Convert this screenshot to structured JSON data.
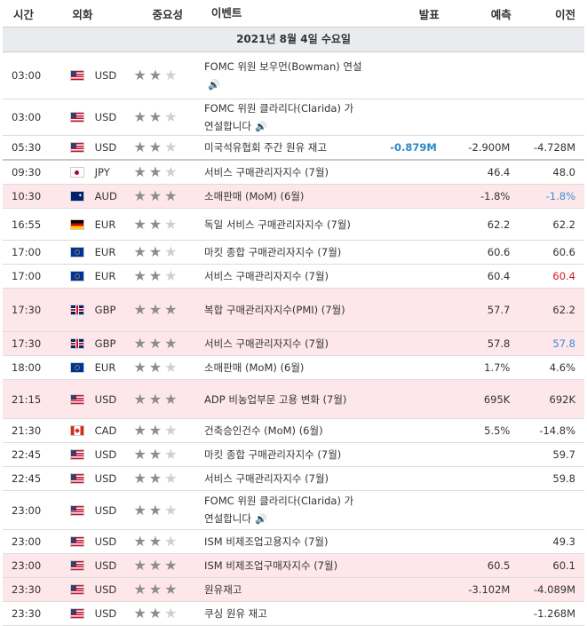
{
  "header": {
    "time": "시간",
    "currency": "외화",
    "importance": "중요성",
    "event": "이벤트",
    "actual": "발표",
    "forecast": "예측",
    "previous": "이전"
  },
  "date_label": "2021년 8월 4일 수요일",
  "colors": {
    "highlight_row": "#fde7ea",
    "positive_blue": "#2b88c8",
    "negative_red": "#d6161f"
  },
  "rows": [
    {
      "time": "03:00",
      "flag": "us",
      "currency": "USD",
      "stars": 2,
      "event": "FOMC 위원 보우먼(Bowman) 연설",
      "speech": true,
      "actual": "",
      "forecast": "",
      "previous": "",
      "hl": false
    },
    {
      "time": "03:00",
      "flag": "us",
      "currency": "USD",
      "stars": 2,
      "event": "FOMC 위원 클라리다(Clarida) 가 연설합니다",
      "speech": true,
      "actual": "",
      "forecast": "",
      "previous": "",
      "hl": false
    },
    {
      "time": "05:30",
      "flag": "us",
      "currency": "USD",
      "stars": 2,
      "event": "미국석유협회 주간 원유 재고",
      "speech": false,
      "actual": "-0.879M",
      "actual_style": "blue",
      "forecast": "-2.900M",
      "previous": "-4.728M",
      "hl": false,
      "sep": true
    },
    {
      "time": "09:30",
      "flag": "jp",
      "currency": "JPY",
      "stars": 2,
      "event": "서비스 구매관리자지수 (7월)",
      "speech": false,
      "actual": "",
      "forecast": "46.4",
      "previous": "48.0",
      "hl": false
    },
    {
      "time": "10:30",
      "flag": "au",
      "currency": "AUD",
      "stars": 3,
      "event": "소매판매 (MoM) (6월)",
      "speech": false,
      "actual": "",
      "forecast": "-1.8%",
      "previous": "-1.8%",
      "previous_style": "blue2",
      "hl": true
    },
    {
      "time": "16:55",
      "flag": "de",
      "currency": "EUR",
      "stars": 2,
      "event": "독일 서비스 구매관리자지수 (7월)",
      "speech": false,
      "actual": "",
      "forecast": "62.2",
      "previous": "62.2",
      "hl": false
    },
    {
      "time": "17:00",
      "flag": "eu",
      "currency": "EUR",
      "stars": 2,
      "event": "마킷 종합 구매관리자지수 (7월)",
      "speech": false,
      "actual": "",
      "forecast": "60.6",
      "previous": "60.6",
      "hl": false
    },
    {
      "time": "17:00",
      "flag": "eu",
      "currency": "EUR",
      "stars": 2,
      "event": "서비스 구매관리자지수 (7월)",
      "speech": false,
      "actual": "",
      "forecast": "60.4",
      "previous": "60.4",
      "previous_style": "red",
      "hl": false
    },
    {
      "time": "17:30",
      "flag": "gb",
      "currency": "GBP",
      "stars": 3,
      "event": "복합 구매관리자지수(PMI) (7월)",
      "speech": false,
      "actual": "",
      "forecast": "57.7",
      "previous": "62.2",
      "hl": true
    },
    {
      "time": "17:30",
      "flag": "gb",
      "currency": "GBP",
      "stars": 3,
      "event": "서비스 구매관리자지수 (7월)",
      "speech": false,
      "actual": "",
      "forecast": "57.8",
      "previous": "57.8",
      "previous_style": "blue2",
      "hl": true
    },
    {
      "time": "18:00",
      "flag": "eu",
      "currency": "EUR",
      "stars": 2,
      "event": "소매판매 (MoM) (6월)",
      "speech": false,
      "actual": "",
      "forecast": "1.7%",
      "previous": "4.6%",
      "hl": false
    },
    {
      "time": "21:15",
      "flag": "us",
      "currency": "USD",
      "stars": 3,
      "event": "ADP 비농업부문 고용 변화 (7월)",
      "speech": false,
      "actual": "",
      "forecast": "695K",
      "previous": "692K",
      "hl": true
    },
    {
      "time": "21:30",
      "flag": "ca",
      "currency": "CAD",
      "stars": 2,
      "event": "건축승인건수 (MoM) (6월)",
      "speech": false,
      "actual": "",
      "forecast": "5.5%",
      "previous": "-14.8%",
      "hl": false
    },
    {
      "time": "22:45",
      "flag": "us",
      "currency": "USD",
      "stars": 2,
      "event": "마킷 종합 구매관리자지수 (7월)",
      "speech": false,
      "actual": "",
      "forecast": "",
      "previous": "59.7",
      "hl": false
    },
    {
      "time": "22:45",
      "flag": "us",
      "currency": "USD",
      "stars": 2,
      "event": "서비스 구매관리자지수 (7월)",
      "speech": false,
      "actual": "",
      "forecast": "",
      "previous": "59.8",
      "hl": false
    },
    {
      "time": "23:00",
      "flag": "us",
      "currency": "USD",
      "stars": 2,
      "event": "FOMC 위원 클라리다(Clarida) 가 연설합니다",
      "speech": true,
      "actual": "",
      "forecast": "",
      "previous": "",
      "hl": false
    },
    {
      "time": "23:00",
      "flag": "us",
      "currency": "USD",
      "stars": 2,
      "event": "ISM 비제조업고용지수 (7월)",
      "speech": false,
      "actual": "",
      "forecast": "",
      "previous": "49.3",
      "hl": false
    },
    {
      "time": "23:00",
      "flag": "us",
      "currency": "USD",
      "stars": 3,
      "event": "ISM 비제조업구매자지수 (7월)",
      "speech": false,
      "actual": "",
      "forecast": "60.5",
      "previous": "60.1",
      "hl": true
    },
    {
      "time": "23:30",
      "flag": "us",
      "currency": "USD",
      "stars": 3,
      "event": "원유재고",
      "speech": false,
      "actual": "",
      "forecast": "-3.102M",
      "previous": "-4.089M",
      "hl": true
    },
    {
      "time": "23:30",
      "flag": "us",
      "currency": "USD",
      "stars": 2,
      "event": "쿠싱 원유 재고",
      "speech": false,
      "actual": "",
      "forecast": "",
      "previous": "-1.268M",
      "hl": false
    }
  ]
}
